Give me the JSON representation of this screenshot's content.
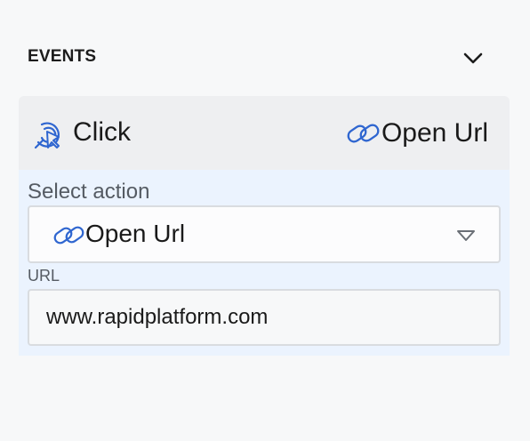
{
  "events_section": {
    "title": "EVENTS",
    "toggle_icon": "chevron-down-icon"
  },
  "event": {
    "trigger_icon": "cursor-click-icon",
    "trigger_label": "Click",
    "action_icon": "link-icon",
    "action_label": "Open Url"
  },
  "select_action": {
    "label": "Select action",
    "icon": "link-icon",
    "value": "Open Url",
    "dropdown_icon": "caret-down-icon"
  },
  "url_field": {
    "label": "URL",
    "value": "www.rapidplatform.com"
  },
  "colors": {
    "accent": "#2f66d0",
    "card_bg": "#eeeff1",
    "details_bg": "#ebf3fe"
  }
}
